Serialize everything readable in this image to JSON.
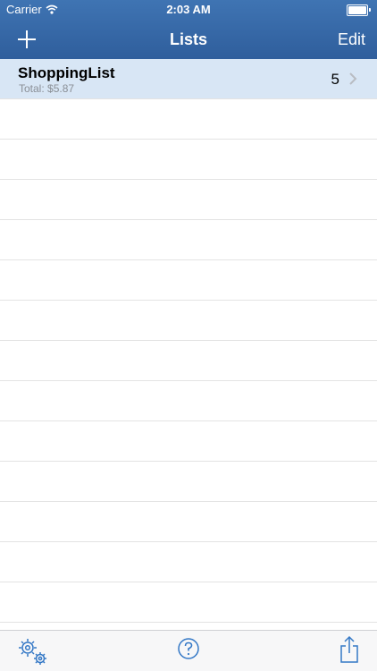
{
  "status_bar": {
    "carrier": "Carrier",
    "time": "2:03 AM"
  },
  "nav": {
    "title": "Lists",
    "edit_label": "Edit"
  },
  "lists": [
    {
      "name": "ShoppingList",
      "total": "Total: $5.87",
      "count": "5"
    }
  ],
  "empty_rows": 13,
  "colors": {
    "nav_bar": "#2f5e9c",
    "selected_row": "#d8e6f5",
    "accent_icon": "#3478c6"
  },
  "icons": [
    "wifi-icon",
    "battery-icon",
    "plus-icon",
    "chevron-right-icon",
    "settings-gears-icon",
    "help-icon",
    "share-icon"
  ]
}
